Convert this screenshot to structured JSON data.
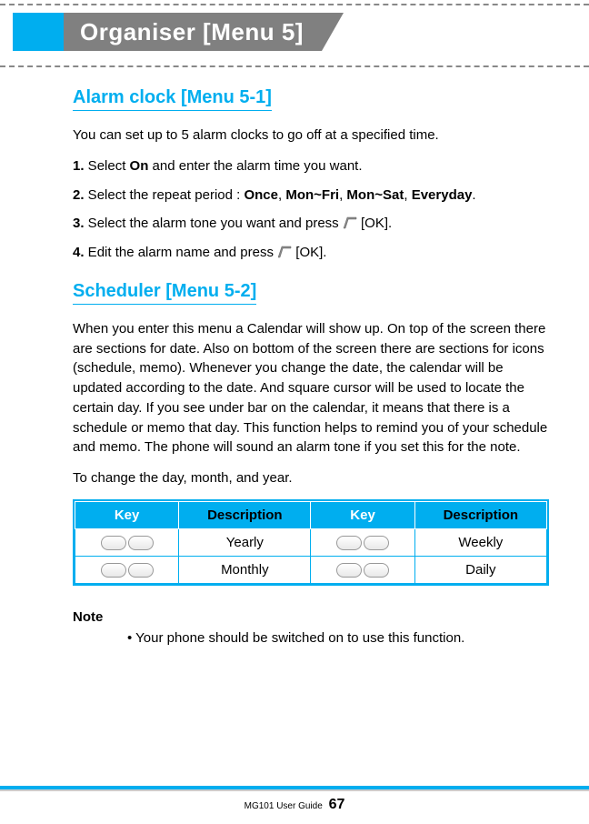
{
  "header": {
    "title": "Organiser [Menu 5]"
  },
  "section1": {
    "heading": "Alarm clock [Menu 5-1]",
    "intro": "You can set up to 5 alarm clocks to go off at a specified time.",
    "step1_num": "1.",
    "step1_a": " Select ",
    "step1_b": "On",
    "step1_c": " and enter the alarm time you want.",
    "step2_num": "2.",
    "step2_a": " Select the repeat period : ",
    "step2_b1": "Once",
    "step2_sep1": ", ",
    "step2_b2": "Mon~Fri",
    "step2_sep2": ", ",
    "step2_b3": "Mon~Sat",
    "step2_sep3": ", ",
    "step2_b4": "Everyday",
    "step2_end": ".",
    "step3_num": "3.",
    "step3_a": " Select the alarm tone you want and press ",
    "step3_b": " [OK].",
    "step4_num": "4.",
    "step4_a": " Edit the alarm name and press ",
    "step4_b": " [OK]."
  },
  "section2": {
    "heading": "Scheduler [Menu 5-2]",
    "para1": "When you enter this menu a Calendar will show up. On top of the screen there are sections for date. Also on bottom of the screen there are sections for icons (schedule, memo). Whenever you change the date, the calendar will be updated according to the date. And square cursor will be used to locate the certain day. If you see under bar on the calendar, it means that there is a schedule or memo that day. This function helps to remind you of your schedule and memo. The phone will sound an alarm tone if you set this for the note.",
    "para2": "To change the day, month, and year."
  },
  "table": {
    "h1": "Key",
    "h2": "Description",
    "h3": "Key",
    "h4": "Description",
    "r1d1": "Yearly",
    "r1d2": "Weekly",
    "r2d1": "Monthly",
    "r2d2": "Daily"
  },
  "note": {
    "label": "Note",
    "body": "• Your phone should be switched on to use this function."
  },
  "footer": {
    "guide": "MG101 User Guide",
    "page": "67"
  }
}
